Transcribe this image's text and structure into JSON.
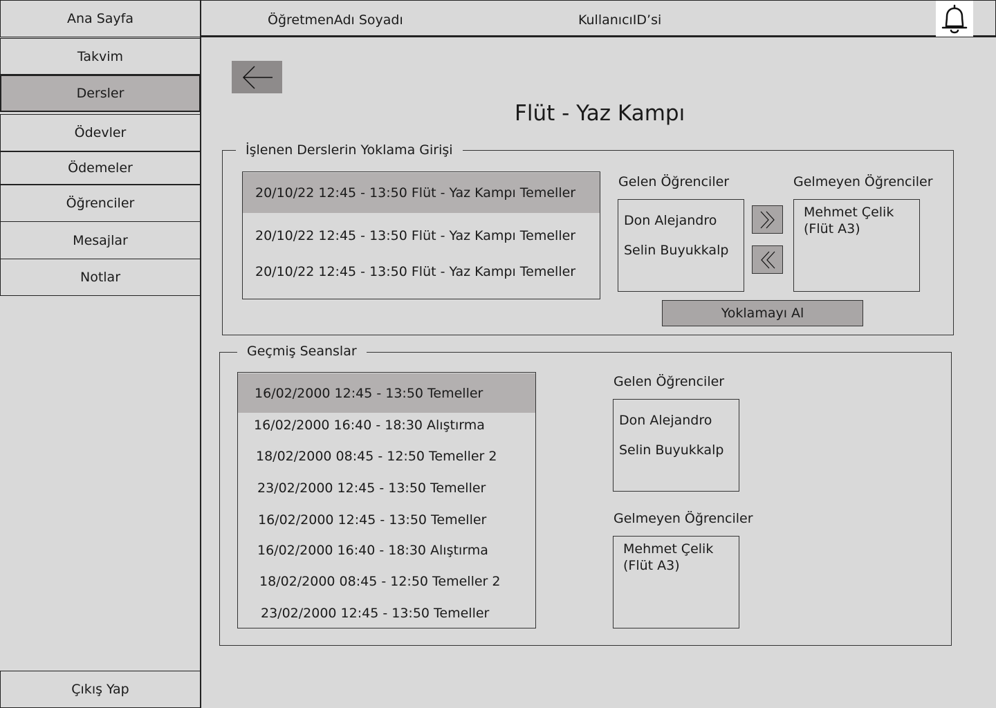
{
  "sidebar": {
    "items": [
      {
        "label": "Ana Sayfa"
      },
      {
        "label": "Takvim"
      },
      {
        "label": "Dersler"
      },
      {
        "label": "Ödevler"
      },
      {
        "label": "Ödemeler"
      },
      {
        "label": "Öğrenciler"
      },
      {
        "label": "Mesajlar"
      },
      {
        "label": "Notlar"
      }
    ],
    "active": "Dersler",
    "logout_label": "Çıkış Yap"
  },
  "header": {
    "teacher_name": "ÖğretmenAdı Soyadı",
    "user_id": "KullanıcıID’si",
    "notification_icon": "bell-icon"
  },
  "page": {
    "back_icon": "arrow-left-icon",
    "title": "Flüt - Yaz Kampı"
  },
  "attendance": {
    "legend": "İşlenen Derslerin Yoklama Girişi",
    "lessons": [
      "20/10/22 12:45 - 13:50 Flüt - Yaz Kampı Temeller",
      "20/10/22 12:45 - 13:50 Flüt - Yaz Kampı Temeller",
      "20/10/22 12:45 - 13:50 Flüt - Yaz Kampı Temeller"
    ],
    "present_label": "Gelen Öğrenciler",
    "present": [
      "Don Alejandro",
      "Selin Buyukkalp"
    ],
    "absent_label": "Gelmeyen Öğrenciler",
    "absent": [
      "Mehmet Çelik",
      "(Flüt A3)"
    ],
    "move_right_icon": "double-chevron-right-icon",
    "move_left_icon": "double-chevron-left-icon",
    "submit_label": "Yoklamayı Al"
  },
  "history": {
    "legend": "Geçmiş Seanslar",
    "sessions": [
      "16/02/2000 12:45 - 13:50 Temeller",
      "16/02/2000 16:40 - 18:30 Alıştırma",
      "18/02/2000 08:45 - 12:50 Temeller 2",
      "23/02/2000 12:45 - 13:50 Temeller",
      "16/02/2000 12:45 - 13:50 Temeller",
      "16/02/2000 16:40 - 18:30 Alıştırma",
      "18/02/2000 08:45 - 12:50 Temeller 2",
      "23/02/2000 12:45 - 13:50 Temeller"
    ],
    "present_label": "Gelen Öğrenciler",
    "present": [
      "Don Alejandro",
      "Selin Buyukkalp"
    ],
    "absent_label": "Gelmeyen Öğrenciler",
    "absent": [
      "Mehmet Çelik",
      "(Flüt A3)"
    ]
  }
}
